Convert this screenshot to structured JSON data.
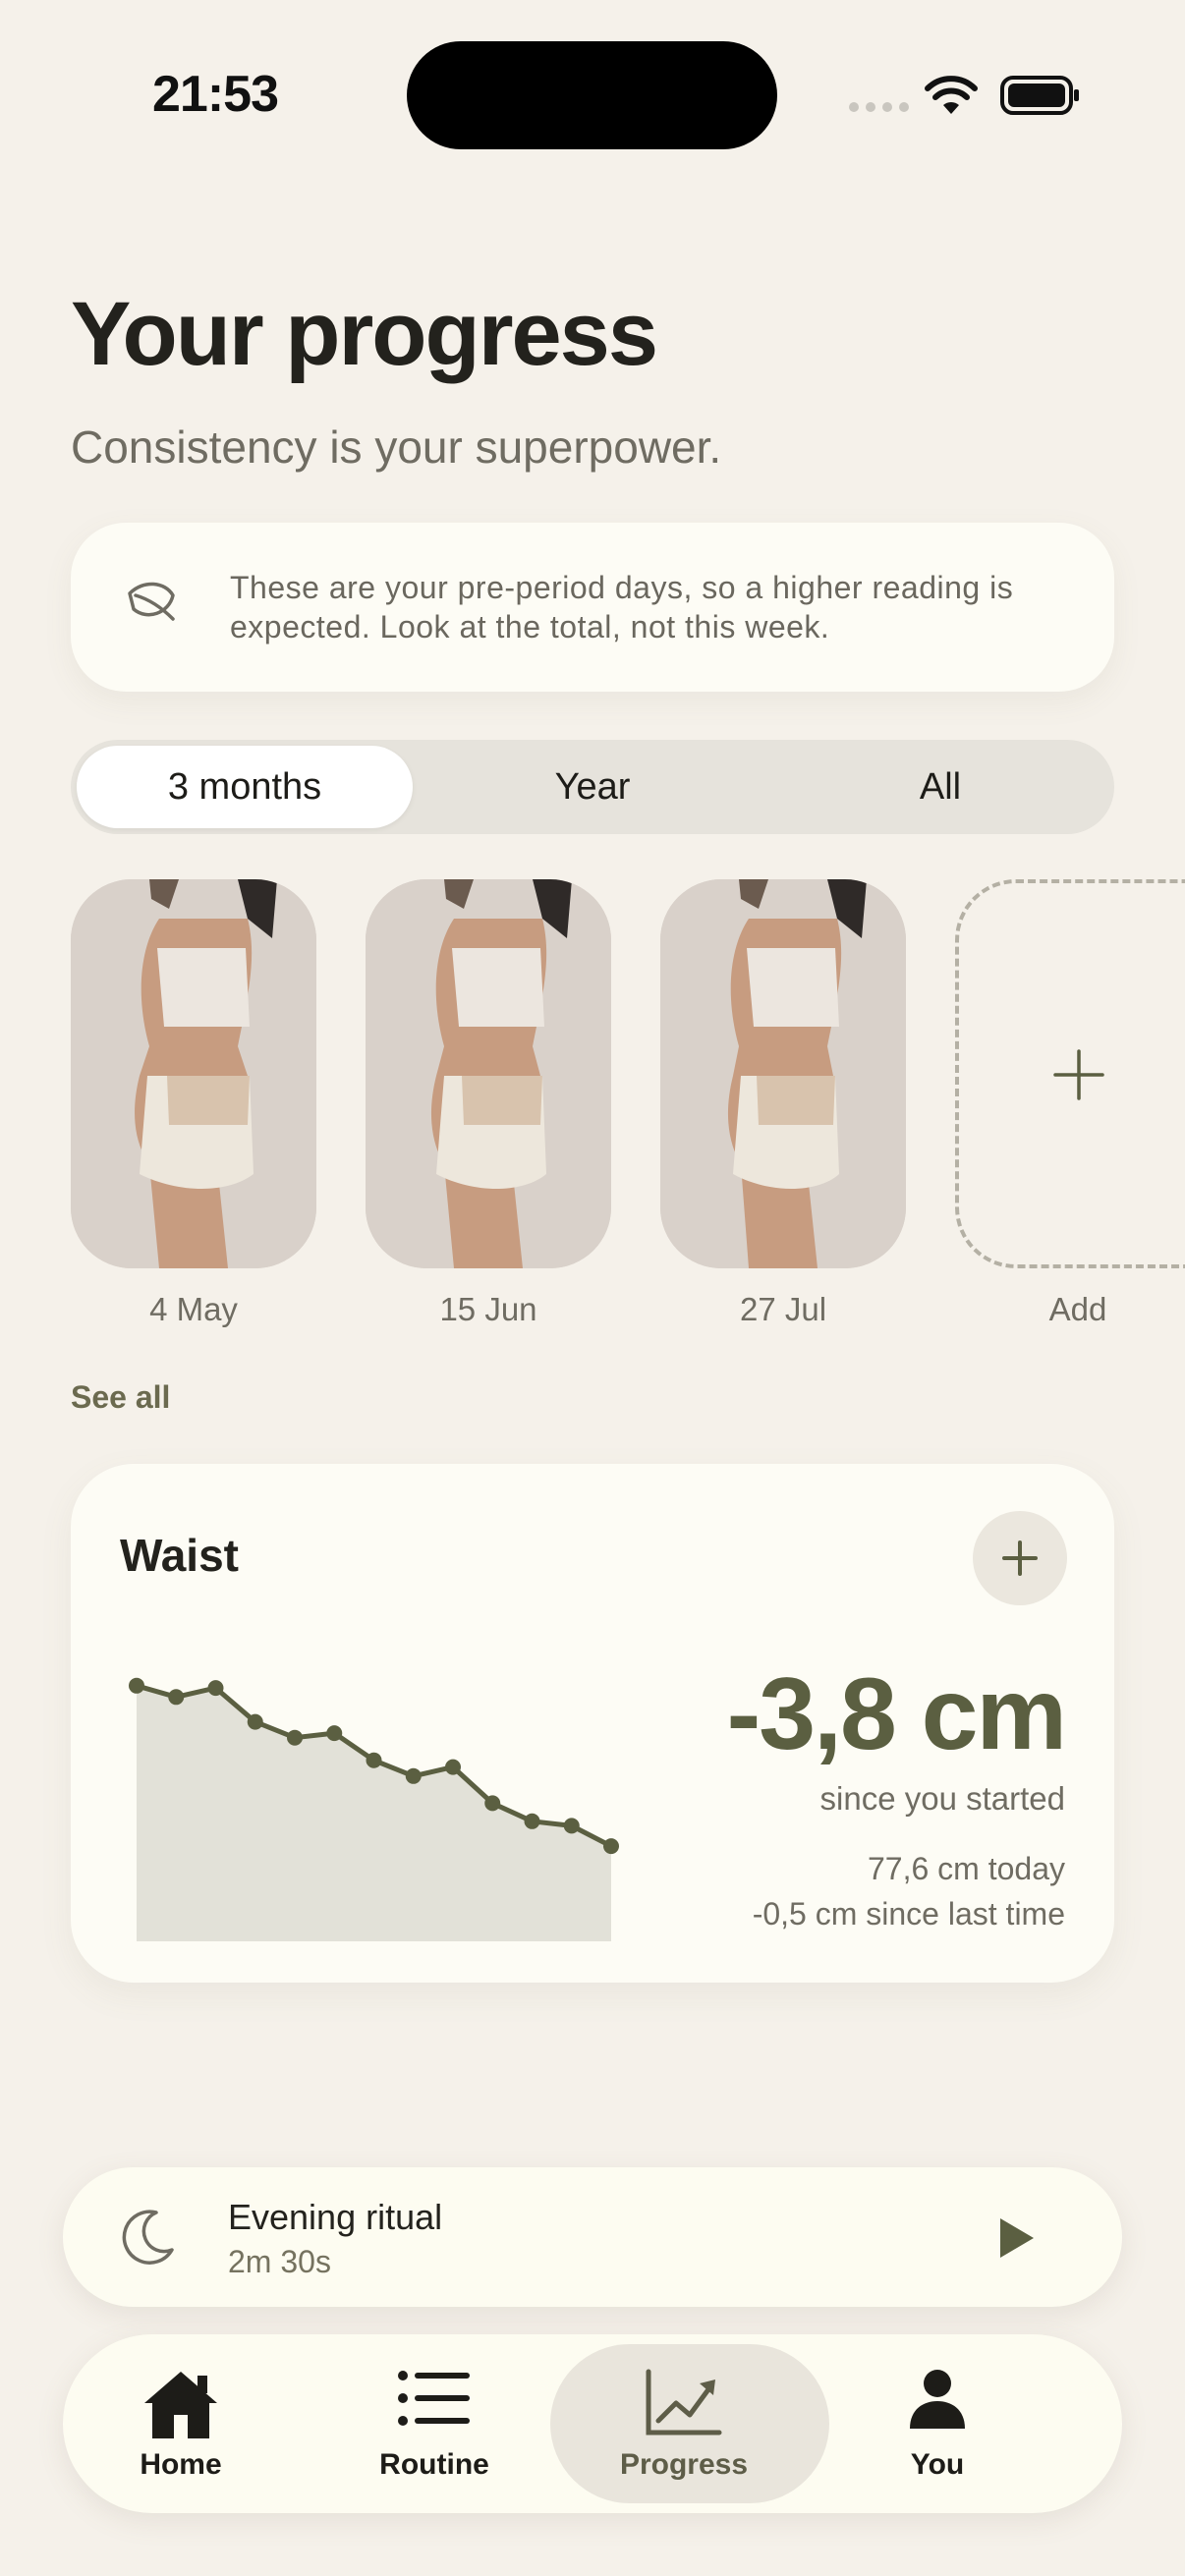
{
  "status_bar": {
    "time": "21:53"
  },
  "header": {
    "title": "Your progress",
    "subtitle": "Consistency is your superpower."
  },
  "note": {
    "icon": "leaf-icon",
    "text": "These are your pre-period days, so a higher reading is expected. Look at the total, not this week."
  },
  "range_selector": {
    "options": [
      "3 months",
      "Year",
      "All"
    ],
    "selected": "3 months"
  },
  "photos": {
    "items": [
      {
        "label": "4 May"
      },
      {
        "label": "15 Jun"
      },
      {
        "label": "27 Jul"
      }
    ],
    "add_label": "Add",
    "see_all": "See all"
  },
  "waist_card": {
    "title": "Waist",
    "change": "-3,8 cm",
    "since_label": "since you started",
    "today": "77,6 cm today",
    "since_last": "-0,5 cm since last time"
  },
  "chart_data": {
    "type": "area",
    "title": "Waist",
    "series": [
      {
        "values": [
          81.4,
          80.9,
          81.3,
          79.8,
          79.1,
          79.3,
          78.1,
          77.4,
          77.8,
          76.2,
          75.4,
          75.2,
          74.3
        ]
      }
    ],
    "ylim": [
      72,
      82
    ],
    "grid": false,
    "color": "#5b5f41",
    "fill": "#e2e1d8"
  },
  "ritual": {
    "name": "Evening ritual",
    "duration": "2m 30s"
  },
  "tab_bar": {
    "items": [
      {
        "label": "Home",
        "icon": "home-icon"
      },
      {
        "label": "Routine",
        "icon": "list-icon"
      },
      {
        "label": "Progress",
        "icon": "chart-icon"
      },
      {
        "label": "You",
        "icon": "person-icon"
      }
    ],
    "active": "Progress"
  },
  "colors": {
    "background": "#f5f1ea",
    "card": "#fdfcf5",
    "accent": "#5b5f41"
  }
}
